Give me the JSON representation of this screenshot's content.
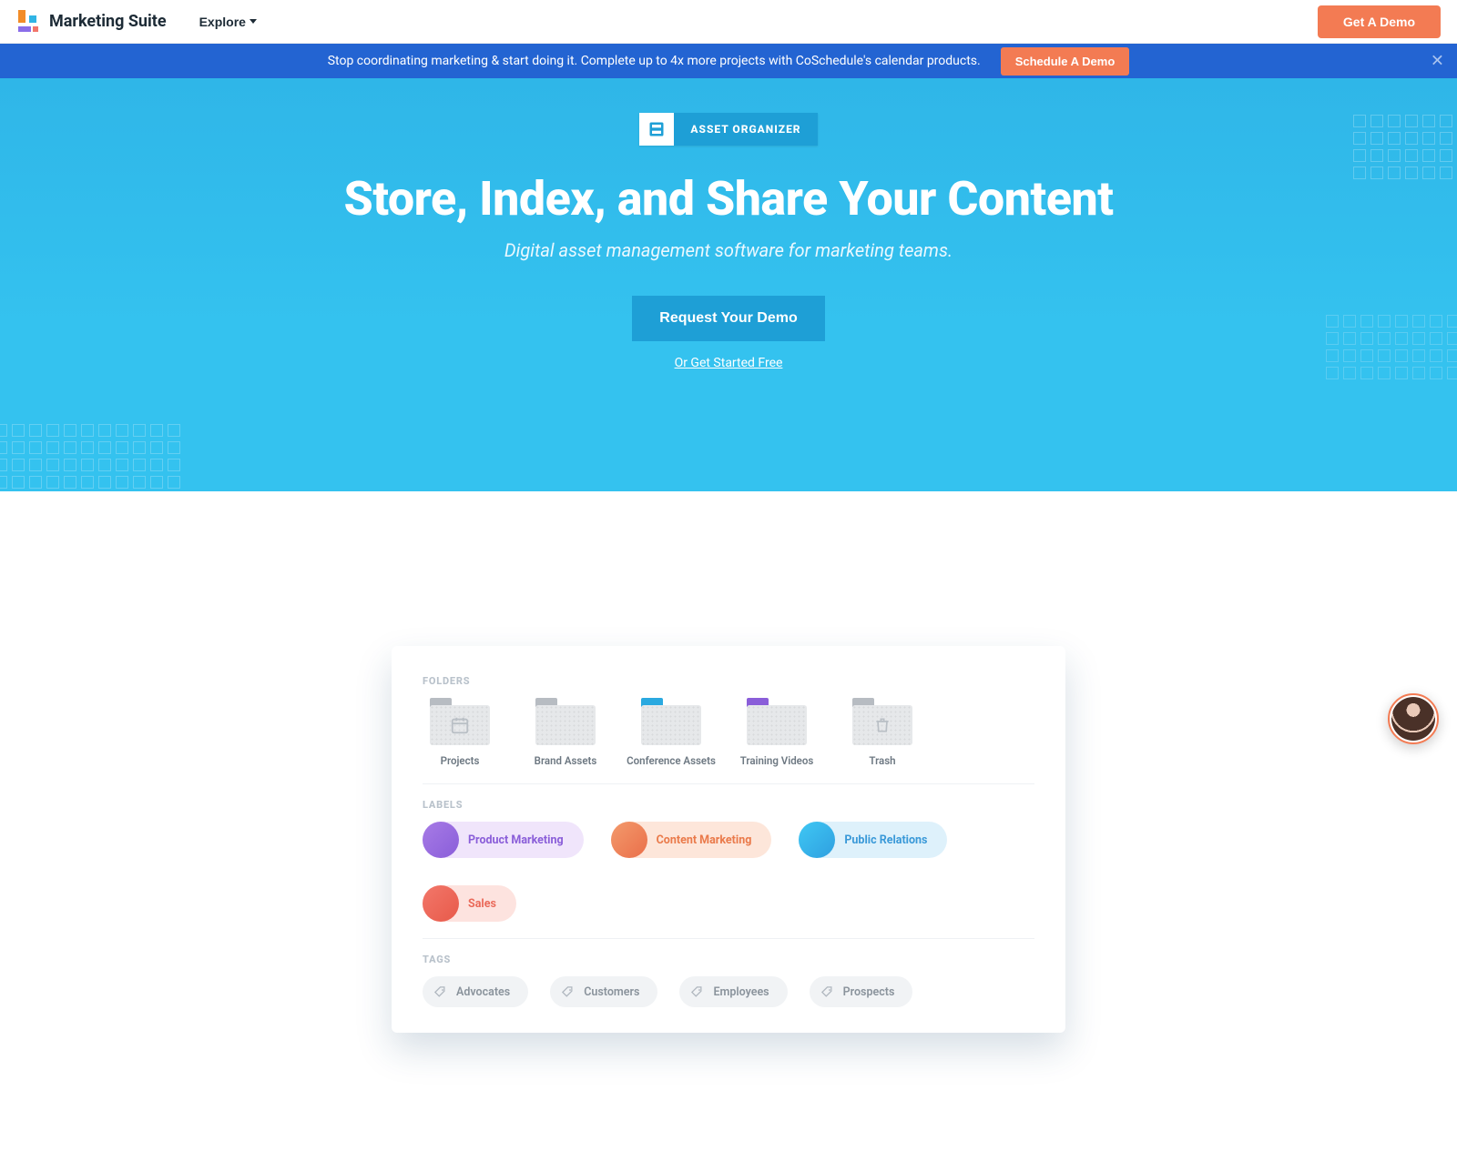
{
  "nav": {
    "brand": "Marketing Suite",
    "explore": "Explore",
    "demo_button": "Get A Demo"
  },
  "announce": {
    "text": "Stop coordinating marketing & start doing it. Complete up to 4x more projects with CoSchedule's calendar products.",
    "cta": "Schedule A Demo"
  },
  "hero": {
    "badge": "ASSET ORGANIZER",
    "title": "Store, Index, and Share Your Content",
    "subtitle": "Digital asset management software for marketing teams.",
    "cta": "Request Your Demo",
    "alt_link": "Or Get Started Free"
  },
  "card": {
    "folders_title": "FOLDERS",
    "labels_title": "LABELS",
    "tags_title": "TAGS",
    "folders": [
      {
        "name": "Projects",
        "tab_color": "#b7bcc2",
        "icon": "calendar"
      },
      {
        "name": "Brand Assets",
        "tab_color": "#b7bcc2",
        "icon": ""
      },
      {
        "name": "Conference Assets",
        "tab_color": "#2aa9e0",
        "icon": ""
      },
      {
        "name": "Training Videos",
        "tab_color": "#8a5ed9",
        "icon": ""
      },
      {
        "name": "Trash",
        "tab_color": "#b7bcc2",
        "icon": "trash"
      }
    ],
    "labels": [
      {
        "name": "Product Marketing",
        "variant": "purple"
      },
      {
        "name": "Content Marketing",
        "variant": "orange"
      },
      {
        "name": "Public Relations",
        "variant": "blue"
      },
      {
        "name": "Sales",
        "variant": "red"
      }
    ],
    "tags": [
      {
        "name": "Advocates"
      },
      {
        "name": "Customers"
      },
      {
        "name": "Employees"
      },
      {
        "name": "Prospects"
      }
    ]
  }
}
